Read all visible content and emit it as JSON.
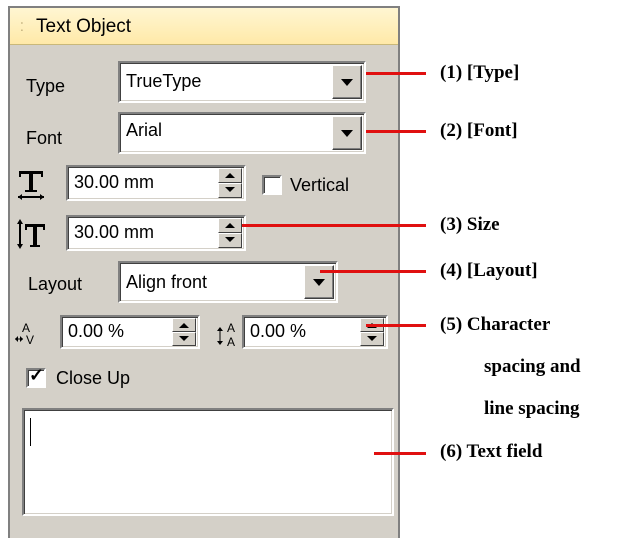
{
  "panel": {
    "title": "Text Object",
    "type_label": "Type",
    "type_value": "TrueType",
    "font_label": "Font",
    "font_value": "Arial",
    "width_value": "30.00 mm",
    "vertical_label": "Vertical",
    "vertical_checked": false,
    "height_value": "30.00 mm",
    "layout_label": "Layout",
    "layout_value": "Align front",
    "char_spacing_value": "0.00 %",
    "line_spacing_value": "0.00 %",
    "closeup_label": "Close Up",
    "closeup_checked": true,
    "text_field_value": ""
  },
  "callouts": {
    "c1": "(1) [Type]",
    "c2": "(2) [Font]",
    "c3": "(3) Size",
    "c4": "(4) [Layout]",
    "c5_line1": "(5)  Character",
    "c5_line2": "spacing and",
    "c5_line3": "line spacing",
    "c6": "(6) Text field"
  },
  "colors": {
    "callout_line": "#e01010",
    "panel_bg": "#d4d0c8",
    "title_bg": "#ffe9a8"
  }
}
